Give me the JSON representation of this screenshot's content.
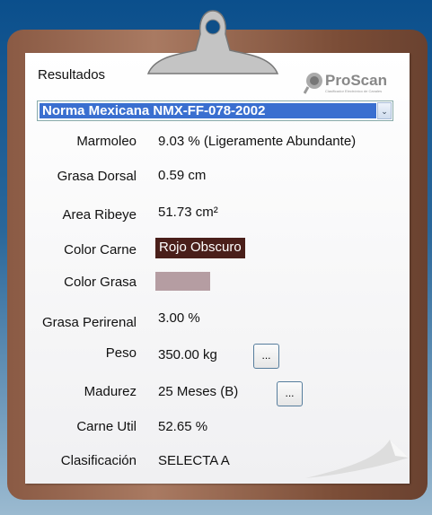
{
  "title": "Resultados",
  "logo": {
    "name": "ProScan",
    "subtitle": "Clasificador Electrónico de Canales"
  },
  "norma_select": {
    "value": "Norma Mexicana NMX-FF-078-2002"
  },
  "fields": [
    {
      "label": "Marmoleo",
      "value": "9.03 % (Ligeramente Abundante)"
    },
    {
      "label": "Grasa Dorsal",
      "value": "0.59 cm"
    },
    {
      "label": "Area Ribeye",
      "value": "51.73 cm²"
    },
    {
      "label": "Color Carne",
      "value": "Rojo Obscuro"
    },
    {
      "label": "Color Grasa",
      "value": ""
    },
    {
      "label": "Grasa Perirenal",
      "value": "3.00 %"
    },
    {
      "label": "Peso",
      "value": "350.00 kg"
    },
    {
      "label": "Madurez",
      "value": "25 Meses (B)"
    },
    {
      "label": "Carne Util",
      "value": "52.65 %"
    },
    {
      "label": "Clasificación",
      "value": "SELECTA A"
    }
  ],
  "buttons": {
    "peso": "...",
    "madurez": "..."
  },
  "colors": {
    "color_carne": "#4a1f1a",
    "color_grasa": "#b59da2",
    "selection": "#3a6fd0"
  }
}
